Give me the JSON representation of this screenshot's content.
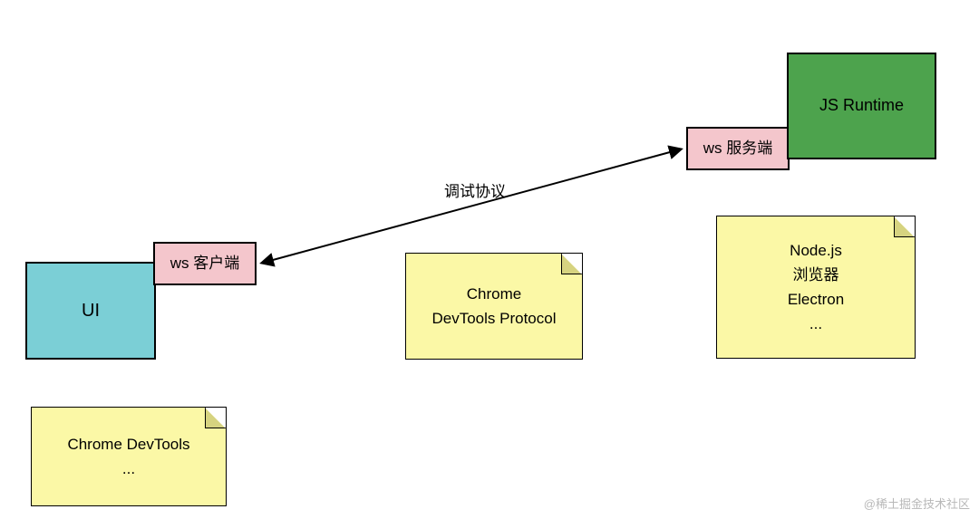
{
  "ui_box": {
    "label": "UI"
  },
  "ws_client": {
    "label": "ws 客户端"
  },
  "ws_server": {
    "label": "ws 服务端"
  },
  "runtime_box": {
    "label": "JS Runtime"
  },
  "arrow": {
    "label": "调试协议"
  },
  "note_left": {
    "text": "Chrome DevTools\n..."
  },
  "note_middle": {
    "text": "Chrome\nDevTools Protocol"
  },
  "note_right": {
    "text": "Node.js\n浏览器\nElectron\n..."
  },
  "watermark": "@稀土掘金技术社区",
  "colors": {
    "ui": "#7bcfd6",
    "ws": "#f4c6cc",
    "runtime": "#4da34d",
    "note": "#fbf8a6"
  }
}
